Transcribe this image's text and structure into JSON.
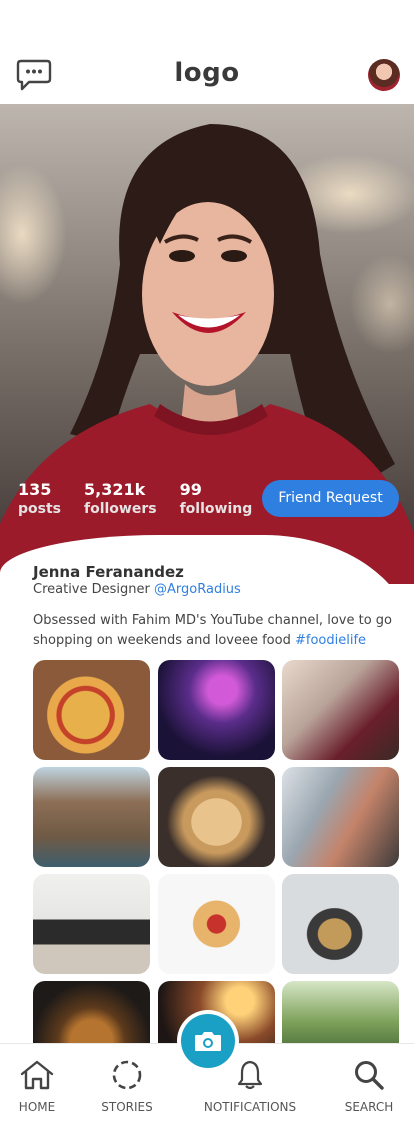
{
  "header": {
    "logo_text": "logo",
    "chat_icon": "chat-bubble-icon"
  },
  "profile": {
    "stats": [
      {
        "value": "135",
        "label": "posts"
      },
      {
        "value": "5,321k",
        "label": "followers"
      },
      {
        "value": "99",
        "label": "following"
      }
    ],
    "friend_request_label": "Friend Request",
    "name": "Jenna Feranandez",
    "role": "Creative Designer",
    "handle": "@ArgoRadius",
    "bio": "Obsessed with Fahim MD's YouTube channel, love to go shopping on weekends and loveee food",
    "bio_tag": "#foodielife"
  },
  "gallery": [
    {
      "name": "pizza-photo"
    },
    {
      "name": "concert-photo"
    },
    {
      "name": "wine-toast-photo"
    },
    {
      "name": "coastal-town-photo"
    },
    {
      "name": "puppy-photo"
    },
    {
      "name": "friends-photo"
    },
    {
      "name": "desk-setup-photo"
    },
    {
      "name": "dessert-photo"
    },
    {
      "name": "cooking-photo"
    },
    {
      "name": "burger-photo"
    },
    {
      "name": "stage-lights-photo"
    },
    {
      "name": "park-photo"
    }
  ],
  "nav": {
    "home": "HOME",
    "stories": "STORIES",
    "notifications": "NOTIFICATIONS",
    "search": "SEARCH"
  },
  "colors": {
    "accent": "#2f7fe0",
    "camera": "#1aa0c4",
    "shirt": "#9c1b2a"
  }
}
